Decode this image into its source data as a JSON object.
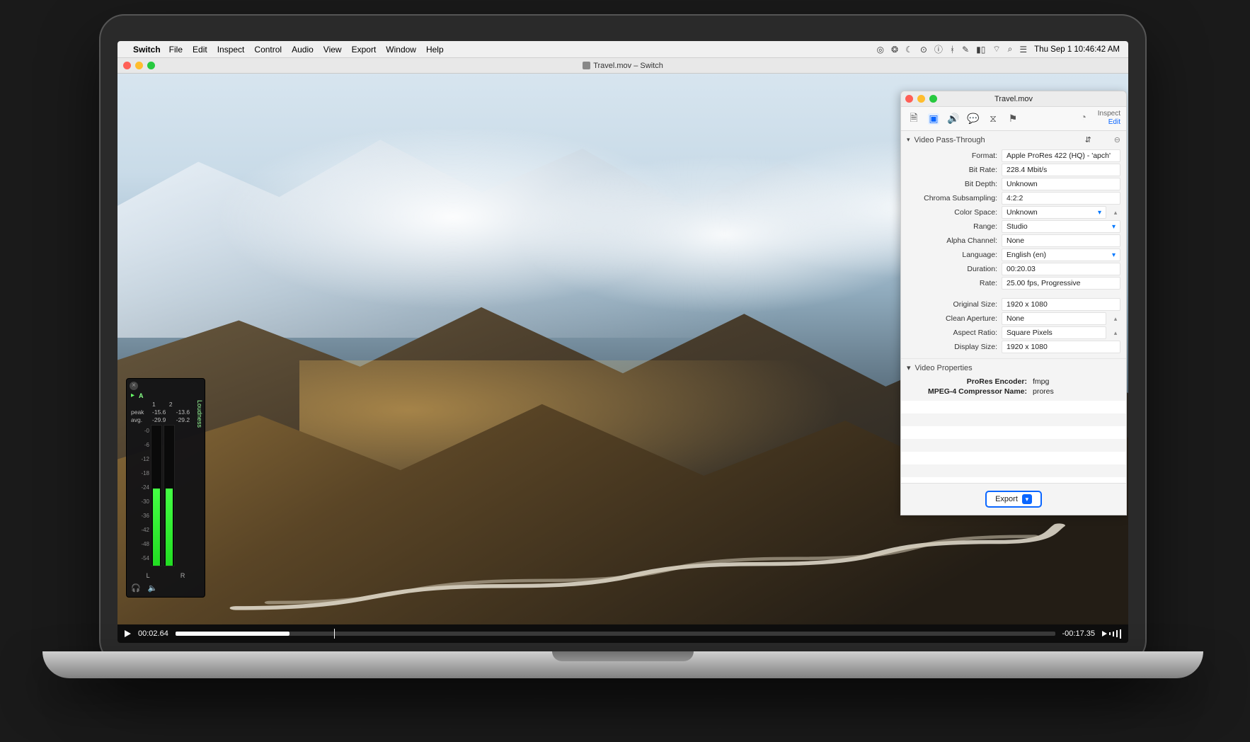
{
  "menubar": {
    "app": "Switch",
    "items": [
      "File",
      "Edit",
      "Inspect",
      "Control",
      "Audio",
      "View",
      "Export",
      "Window",
      "Help"
    ],
    "clock": "Thu Sep 1  10:46:42 AM"
  },
  "player": {
    "title": "Travel.mov – Switch",
    "current_time": "00:02.64",
    "remaining_time": "-00:17.35"
  },
  "meter": {
    "badge": "A",
    "ch1": "1",
    "ch2": "2",
    "side": "Loudness",
    "peak_label": "peak",
    "avg_label": "avg.",
    "peak1": "-15.6",
    "peak2": "-13.6",
    "avg1": "-29.9",
    "avg2": "-29.2",
    "scale": [
      "-0",
      "-6",
      "-12",
      "-18",
      "-24",
      "-30",
      "-36",
      "-42",
      "-48",
      "-54"
    ],
    "L": "L",
    "R": "R"
  },
  "inspector": {
    "title": "Travel.mov",
    "mode_inspect": "Inspect",
    "mode_edit": "Edit",
    "section1": "Video Pass-Through",
    "rows": {
      "format_l": "Format:",
      "format_v": "Apple ProRes 422 (HQ) - 'apch'",
      "bitrate_l": "Bit Rate:",
      "bitrate_v": "228.4 Mbit/s",
      "bitdepth_l": "Bit Depth:",
      "bitdepth_v": "Unknown",
      "chroma_l": "Chroma Subsampling:",
      "chroma_v": "4:2:2",
      "cspace_l": "Color Space:",
      "cspace_v": "Unknown",
      "range_l": "Range:",
      "range_v": "Studio",
      "alpha_l": "Alpha Channel:",
      "alpha_v": "None",
      "lang_l": "Language:",
      "lang_v": "English (en)",
      "dur_l": "Duration:",
      "dur_v": "00:20.03",
      "rate_l": "Rate:",
      "rate_v": "25.00 fps, Progressive",
      "osize_l": "Original Size:",
      "osize_v": "1920 x 1080",
      "cap_l": "Clean Aperture:",
      "cap_v": "None",
      "ar_l": "Aspect Ratio:",
      "ar_v": "Square Pixels",
      "dsize_l": "Display Size:",
      "dsize_v": "1920 x 1080"
    },
    "section2": "Video Properties",
    "kv": {
      "k1": "ProRes Encoder:",
      "v1": "fmpg",
      "k2": "MPEG-4 Compressor Name:",
      "v2": "prores"
    },
    "export": "Export"
  }
}
